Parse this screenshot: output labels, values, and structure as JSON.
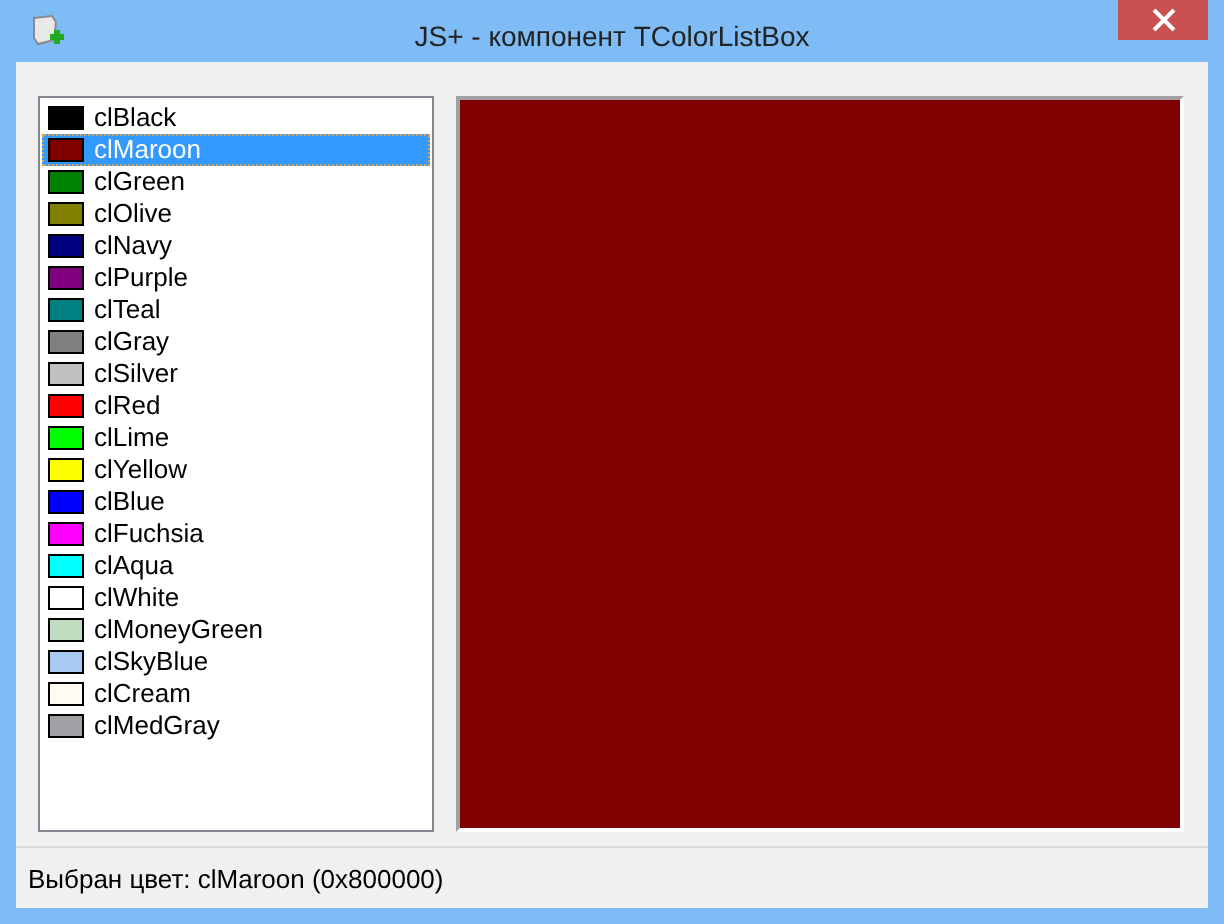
{
  "window": {
    "title": "JS+ - компонент TColorListBox"
  },
  "colors": [
    {
      "name": "clBlack",
      "color": "#000000",
      "selected": false
    },
    {
      "name": "clMaroon",
      "color": "#800000",
      "selected": true
    },
    {
      "name": "clGreen",
      "color": "#008000",
      "selected": false
    },
    {
      "name": "clOlive",
      "color": "#808000",
      "selected": false
    },
    {
      "name": "clNavy",
      "color": "#000080",
      "selected": false
    },
    {
      "name": "clPurple",
      "color": "#800080",
      "selected": false
    },
    {
      "name": "clTeal",
      "color": "#008080",
      "selected": false
    },
    {
      "name": "clGray",
      "color": "#808080",
      "selected": false
    },
    {
      "name": "clSilver",
      "color": "#c0c0c0",
      "selected": false
    },
    {
      "name": "clRed",
      "color": "#ff0000",
      "selected": false
    },
    {
      "name": "clLime",
      "color": "#00ff00",
      "selected": false
    },
    {
      "name": "clYellow",
      "color": "#ffff00",
      "selected": false
    },
    {
      "name": "clBlue",
      "color": "#0000ff",
      "selected": false
    },
    {
      "name": "clFuchsia",
      "color": "#ff00ff",
      "selected": false
    },
    {
      "name": "clAqua",
      "color": "#00ffff",
      "selected": false
    },
    {
      "name": "clWhite",
      "color": "#ffffff",
      "selected": false
    },
    {
      "name": "clMoneyGreen",
      "color": "#c0dcc0",
      "selected": false
    },
    {
      "name": "clSkyBlue",
      "color": "#a6caf0",
      "selected": false
    },
    {
      "name": "clCream",
      "color": "#fffbf0",
      "selected": false
    },
    {
      "name": "clMedGray",
      "color": "#a0a0a4",
      "selected": false
    }
  ],
  "status_bar": "Выбран цвет: clMaroon (0x800000)"
}
